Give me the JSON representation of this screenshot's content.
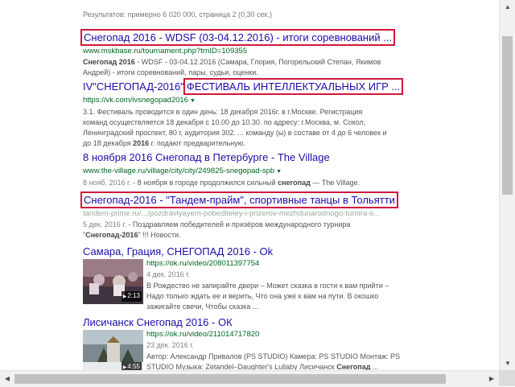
{
  "stats": "Результатов: примерно 6 020 000, страница 2 (0,30 сек.)",
  "results": [
    {
      "title": "Снегопад 2016 - WDSF (03-04.12.2016) - итоги соревнований ...",
      "url": "www.mskbase.ru/tournament.php?trnID=109355",
      "snippet_bold": "Снегопад 2016",
      "snippet": " - WDSF - 03-04.12.2016 (Самара, Глория, Погорельский Степан, Якимов Андрей) - итоги соревнований, пары, судьи, оценки."
    },
    {
      "title_prefix": "IV\"СНЕГОПАД-2016\"",
      "title": "ФЕСТИВАЛЬ ИНТЕЛЛЕКТУАЛЬНЫХ ИГР ...",
      "url": "https://vk.com/ivsnegopad2016",
      "snippet_a": "3.1. Фестиваль проводится в один день: 18 декабря 2016г. в г.Москве. Регистрация команд осуществляется 18 декабря с 10.00 до 10.30. по адресу: г.Москва, м. Сокол, Ленинградский проспект, 80 г, аудитория 302. ... команду (ы) в составе от 4 до 6 человек и до 18 декабря ",
      "snippet_bold": "2016",
      "snippet_b": " г. подают предварительную."
    },
    {
      "title": "8 ноября 2016 Снегопад в Петербурге - The Village",
      "url": "www.the-village.ru/village/city/city/249825-snegopad-spb",
      "date": "8 нояб. 2016 г.",
      "snippet_a": " - 8 ноября в городе продолжился сильный ",
      "snippet_bold": "снегопад",
      "snippet_b": " — The Village."
    },
    {
      "title": "Снегопад-2016 - \"Тандем-прайм\", спортивные танцы в Тольятти",
      "url": "tandem-prime.ru/.../pozdravlyayem-pobediteley-i-prizerov-mezhdunarodnogo-turnira-s...",
      "date": "5 дек. 2016 г.",
      "snippet_a": " - Поздравляем победителей и призёров международного турнира \"",
      "snippet_bold": "Снегопад-2016",
      "snippet_b": "\" !!! Новости."
    }
  ],
  "videos": [
    {
      "title": "Самара, Грация, СНЕГОПАД 2016 - Ok",
      "url": "https://ok.ru/video/208011397754",
      "date": "4 дек. 2016 г.",
      "snippet": "В Рождество не запирайте двери – Может сказка в гости к вам прийти – Надо только ждать ее и верить, Что она уже к вам на пути. В окошко зажигайте свечи, Чтобы сказка ...",
      "duration": "2:13"
    },
    {
      "title": "Лисичанск Снегопад 2016 - ОК",
      "url": "https://ok.ru/video/211014717820",
      "date": "23 дек. 2016 г.",
      "snippet_a": "Автор: Александр Привалов (PS STUDIO) Камера: PS STUDIO Монтаж: PS STUDIO Музыка: Zetandel–Daughter's Lullaby Лисичанск ",
      "snippet_bold": "Снегопад",
      "snippet_b": " ...",
      "duration": "4:55"
    }
  ],
  "icons": {
    "url_dropdown": "caret-down-icon",
    "play": "play-icon",
    "scroll_up": "arrow-up-icon",
    "scroll_down": "arrow-down-icon",
    "scroll_left": "arrow-left-icon",
    "scroll_right": "arrow-right-icon"
  },
  "colors": {
    "link": "#1a0dab",
    "url": "#006621",
    "snippet": "#545454",
    "highlight_box": "#d0183b"
  }
}
